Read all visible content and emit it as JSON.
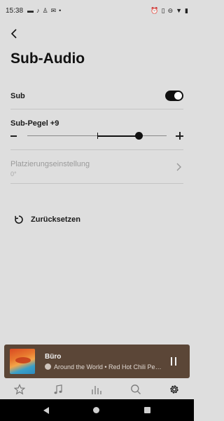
{
  "status_bar": {
    "time": "15:38",
    "left_icons": [
      "sim-card-icon",
      "tiktok-icon",
      "notification-icon",
      "gmail-icon",
      "dot-icon"
    ],
    "right_icons": [
      "alarm-icon",
      "vibrate-icon",
      "do-not-disturb-icon",
      "wifi-icon",
      "battery-icon"
    ]
  },
  "header": {
    "back_icon": "chevron-left-icon",
    "title": "Sub-Audio"
  },
  "settings": {
    "sub": {
      "label": "Sub",
      "enabled": true
    },
    "sub_level": {
      "label": "Sub-Pegel",
      "value": "+9",
      "min": -15,
      "max": 15,
      "current": 9
    },
    "placement": {
      "label": "Platzierungseinstellung",
      "value": "0°"
    },
    "reset": {
      "label": "Zurücksetzen"
    }
  },
  "now_playing": {
    "room": "Büro",
    "track": "Around the World • Red Hot Chili Pep...",
    "service_icon": "spotify-icon",
    "state": "playing"
  },
  "tab_bar": {
    "tabs": [
      {
        "name": "favorites",
        "icon": "star-icon",
        "active": false
      },
      {
        "name": "browse",
        "icon": "music-note-icon",
        "active": false
      },
      {
        "name": "rooms",
        "icon": "equalizer-bars-icon",
        "active": false
      },
      {
        "name": "search",
        "icon": "search-icon",
        "active": false
      },
      {
        "name": "settings",
        "icon": "gear-icon",
        "active": true
      }
    ]
  },
  "colors": {
    "background": "#dedede",
    "now_playing_bg": "#5b4637",
    "accent": "#111111"
  }
}
